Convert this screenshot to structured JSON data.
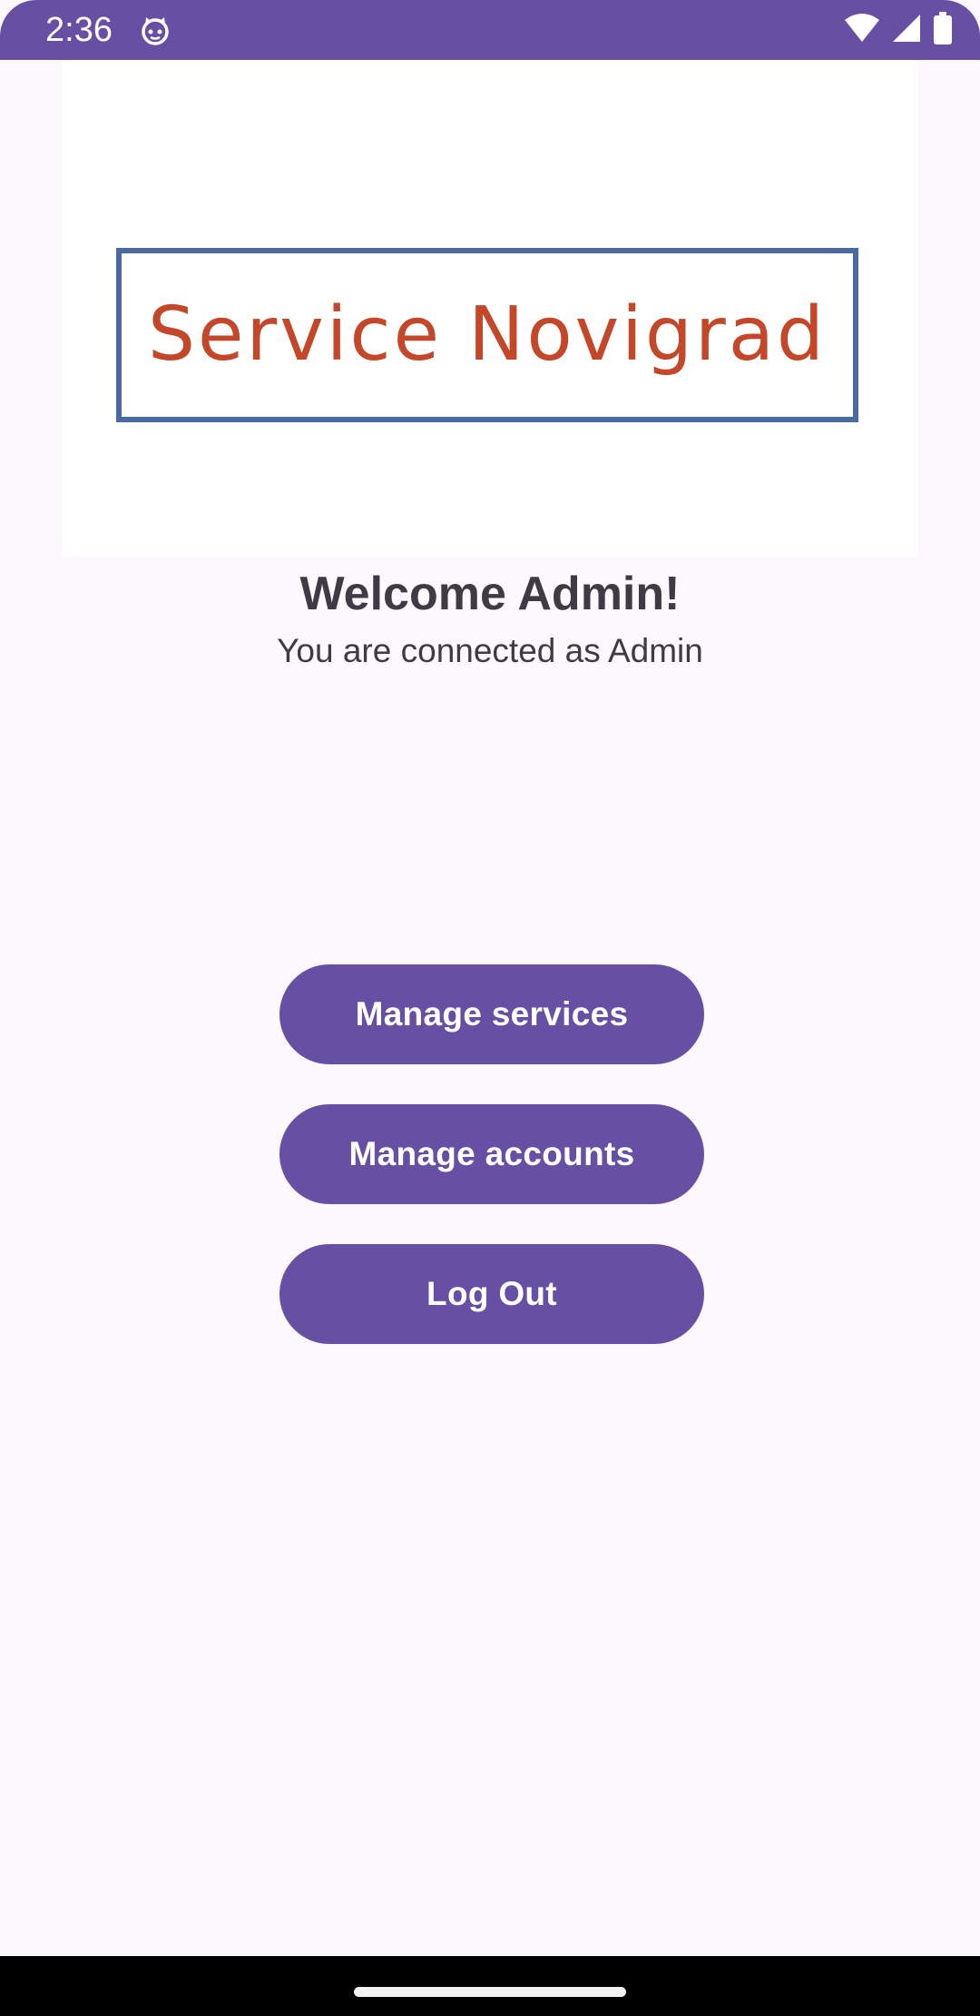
{
  "status_bar": {
    "time": "2:36",
    "icons": [
      "cat-icon",
      "wifi-icon",
      "signal-icon",
      "battery-icon"
    ],
    "color": "#6750a4"
  },
  "logo": {
    "text": "Service Novigrad",
    "text_color": "#c4472a",
    "border_color": "#4a6aa3"
  },
  "welcome": {
    "title": "Welcome Admin!",
    "subtitle": "You are connected as Admin"
  },
  "buttons": {
    "manage_services": "Manage services",
    "manage_accounts": "Manage accounts",
    "log_out": "Log Out",
    "color": "#6750a4"
  }
}
